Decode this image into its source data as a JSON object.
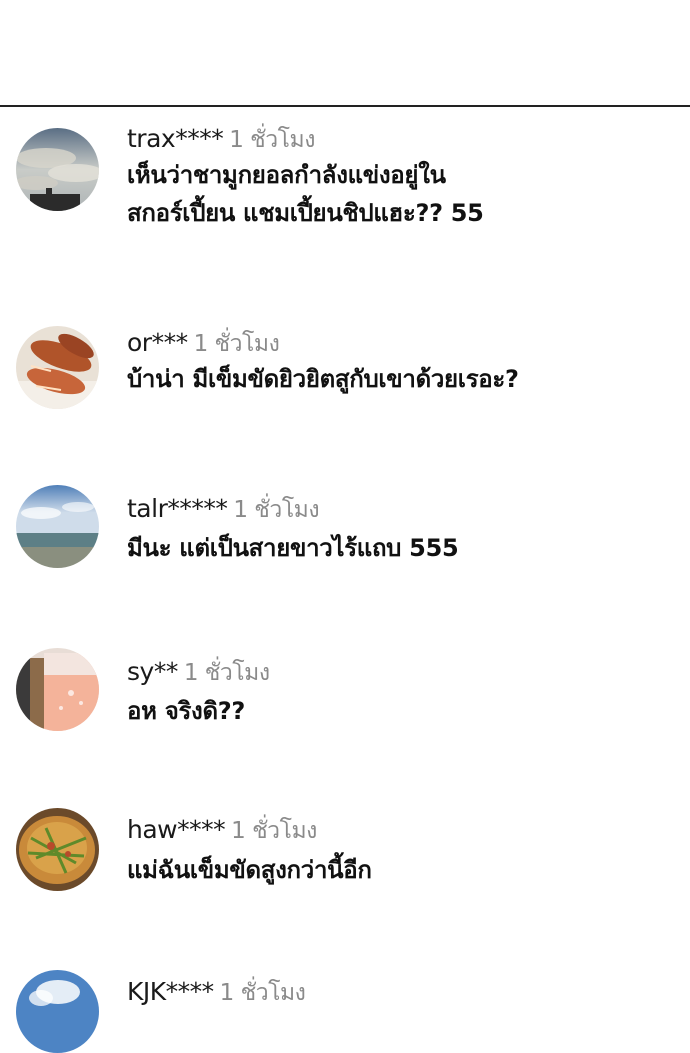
{
  "comments": [
    {
      "username": "trax****",
      "time": "1 ชั่วโมง",
      "lines": [
        "เห็นว่าชามูกยอลกำลังแข่งอยู่ใน",
        "สกอร์เปี้ยน แชมเปี้ยนชิปแฮะ?? 55"
      ],
      "avatar": "sky-clouds-avatar"
    },
    {
      "username": "or***",
      "time": "1 ชั่วโมง",
      "lines": [
        "บ้าน่า มีเข็มขัดยิวยิตสูกับเขาด้วยเรอะ?"
      ],
      "avatar": "shrimp-dish-avatar"
    },
    {
      "username": "talr*****",
      "time": "1 ชั่วโมง",
      "lines": [
        "มีนะ แต่เป็นสายขาวไร้แถบ 555"
      ],
      "avatar": "sea-beach-avatar"
    },
    {
      "username": "sy**",
      "time": "1 ชั่วโมง",
      "lines": [
        "อห จริงดิ??"
      ],
      "avatar": "drink-glass-avatar"
    },
    {
      "username": "haw****",
      "time": "1 ชั่วโมง",
      "lines": [
        "แม่ฉันเข็มขัดสูงกว่านี้อีก"
      ],
      "avatar": "food-bowl-avatar"
    },
    {
      "username": "KJK****",
      "time": "1 ชั่วโมง",
      "lines": [],
      "avatar": "sky-avatar"
    }
  ]
}
